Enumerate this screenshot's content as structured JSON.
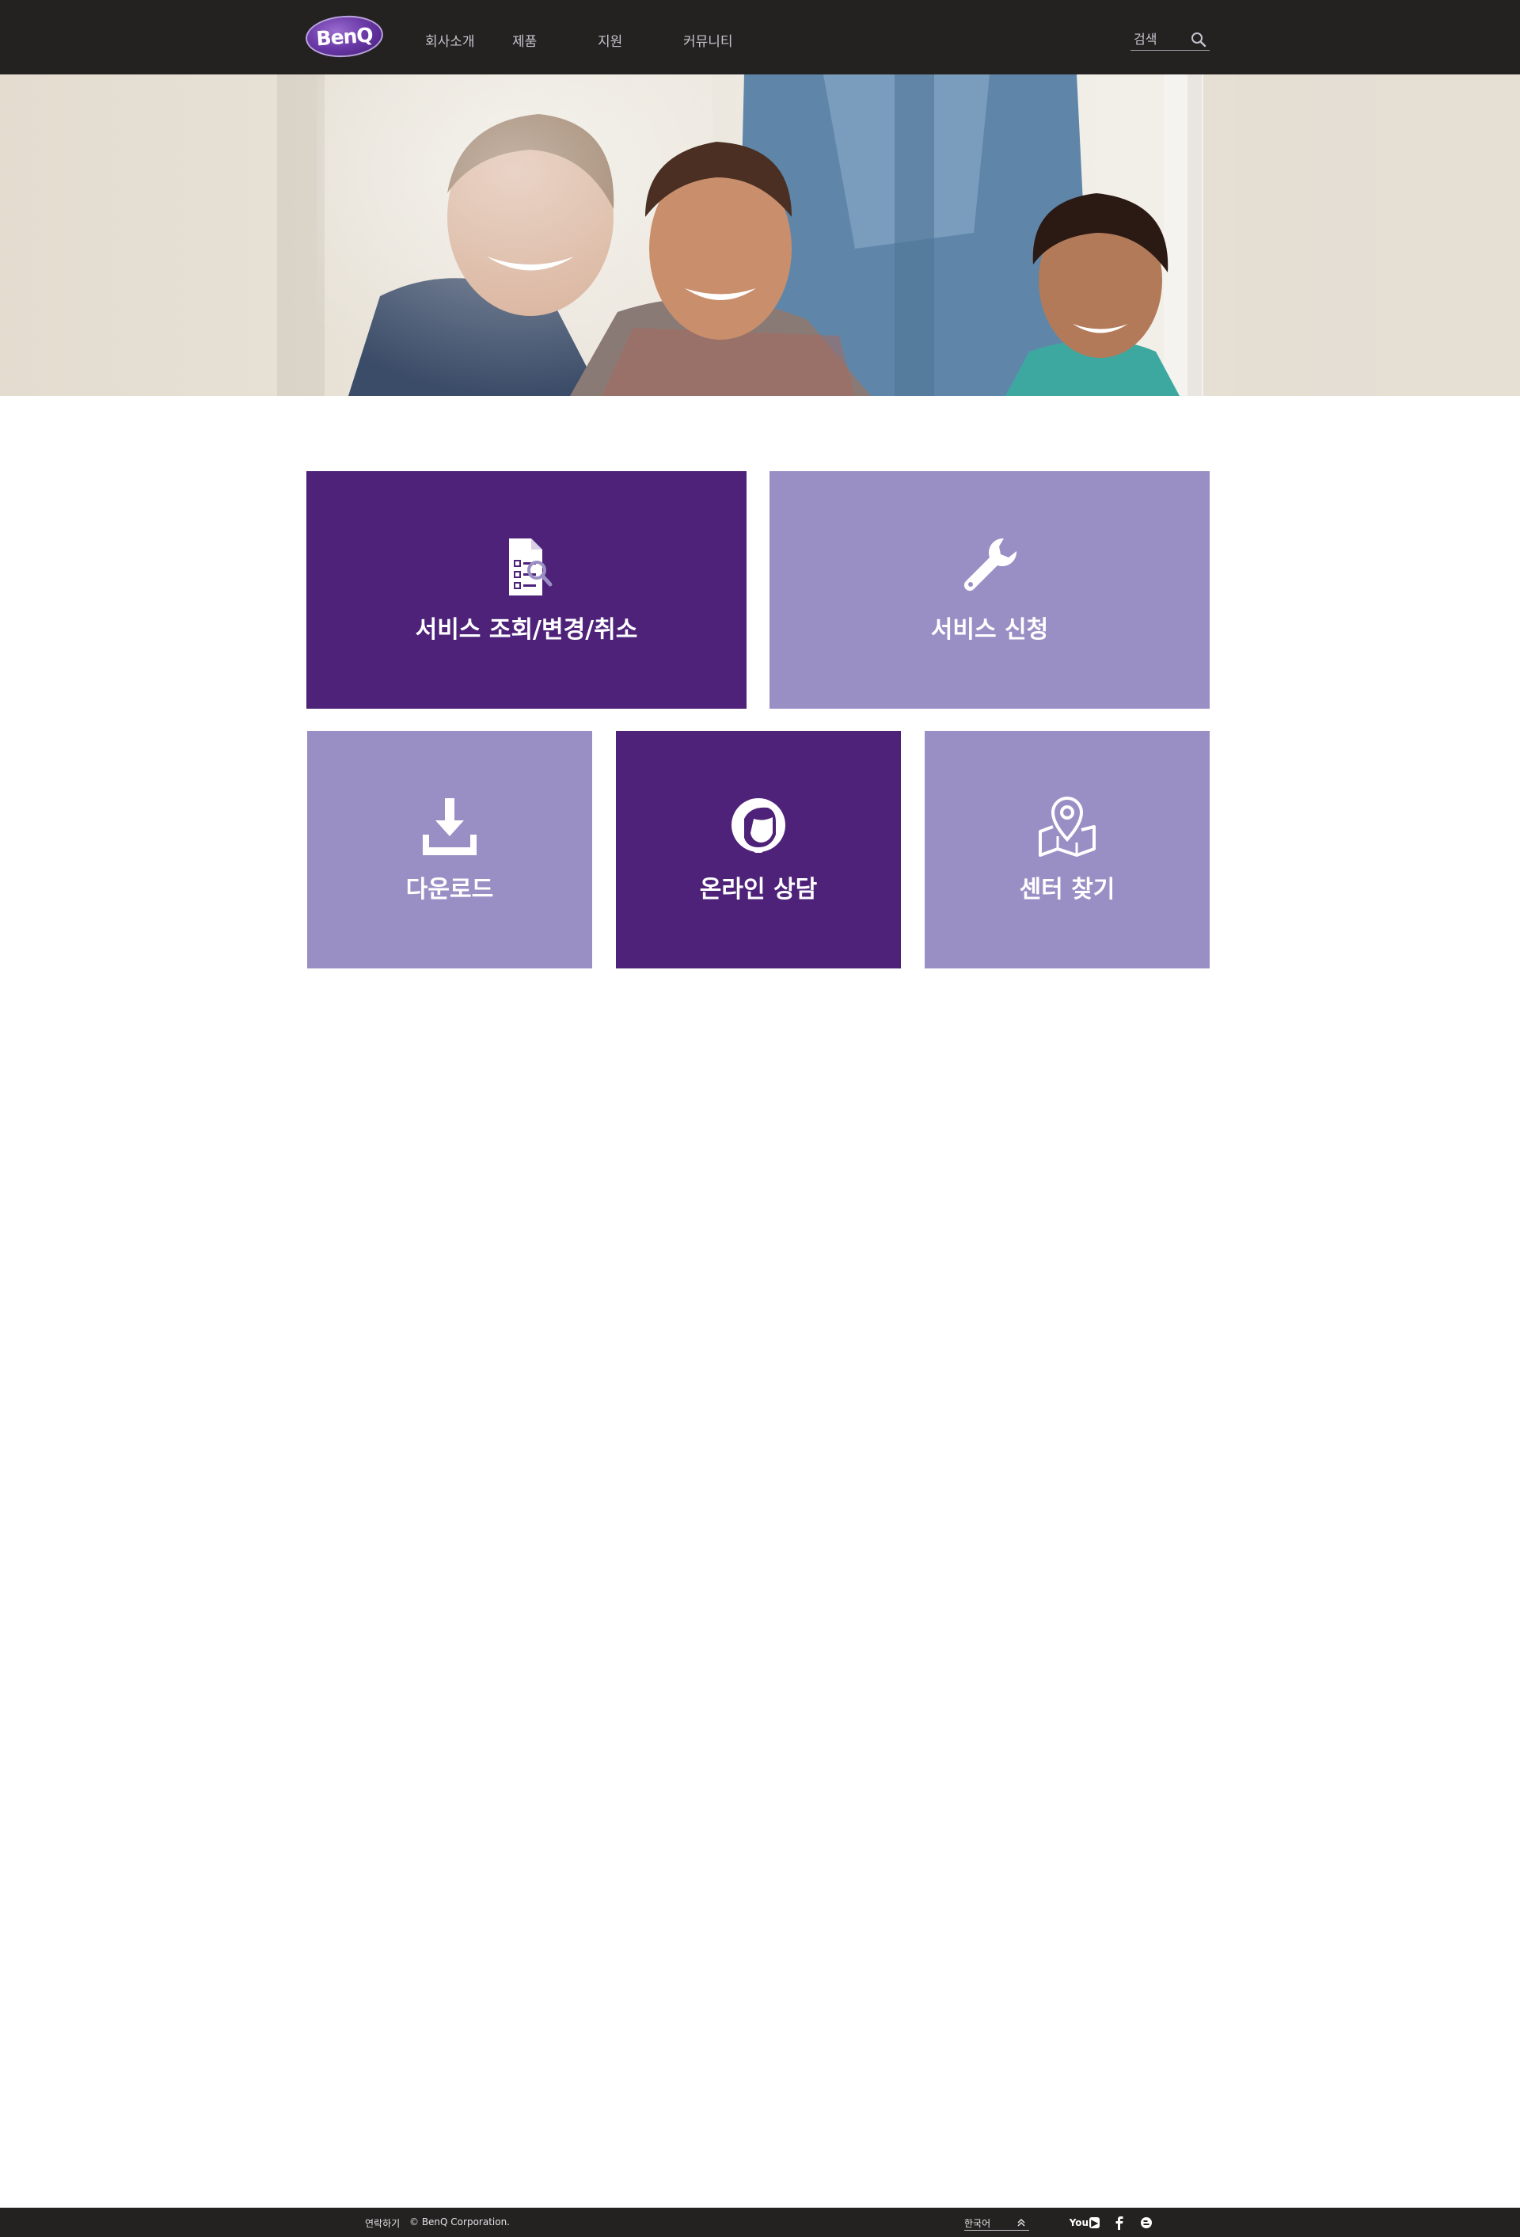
{
  "header": {
    "logo_text": "BenQ",
    "nav": [
      "회사소개",
      "제품",
      "지원",
      "커뮤니티"
    ],
    "search": {
      "placeholder": "검색"
    }
  },
  "hero": {
    "image": "four smiling coworkers in an office"
  },
  "tiles": [
    {
      "label": "서비스 조회/변경/취소",
      "icon": "document-search-icon",
      "style": "dark"
    },
    {
      "label": "서비스 신청",
      "icon": "wrench-icon",
      "style": "light"
    },
    {
      "label": "다운로드",
      "icon": "download-icon",
      "style": "light"
    },
    {
      "label": "온라인 상담",
      "icon": "headset-icon",
      "style": "dark"
    },
    {
      "label": "센터 찾기",
      "icon": "map-pin-icon",
      "style": "light"
    }
  ],
  "footer": {
    "contact": "연락하기",
    "copyright": "© BenQ Corporation.",
    "language": "한국어",
    "social": [
      "youtube-icon",
      "facebook-icon",
      "blog-icon"
    ],
    "youtube_text": "You"
  },
  "colors": {
    "header_bg": "#232221",
    "tile_dark": "#4d2278",
    "tile_light": "#9a8fc5",
    "footer_bg": "#232221"
  }
}
